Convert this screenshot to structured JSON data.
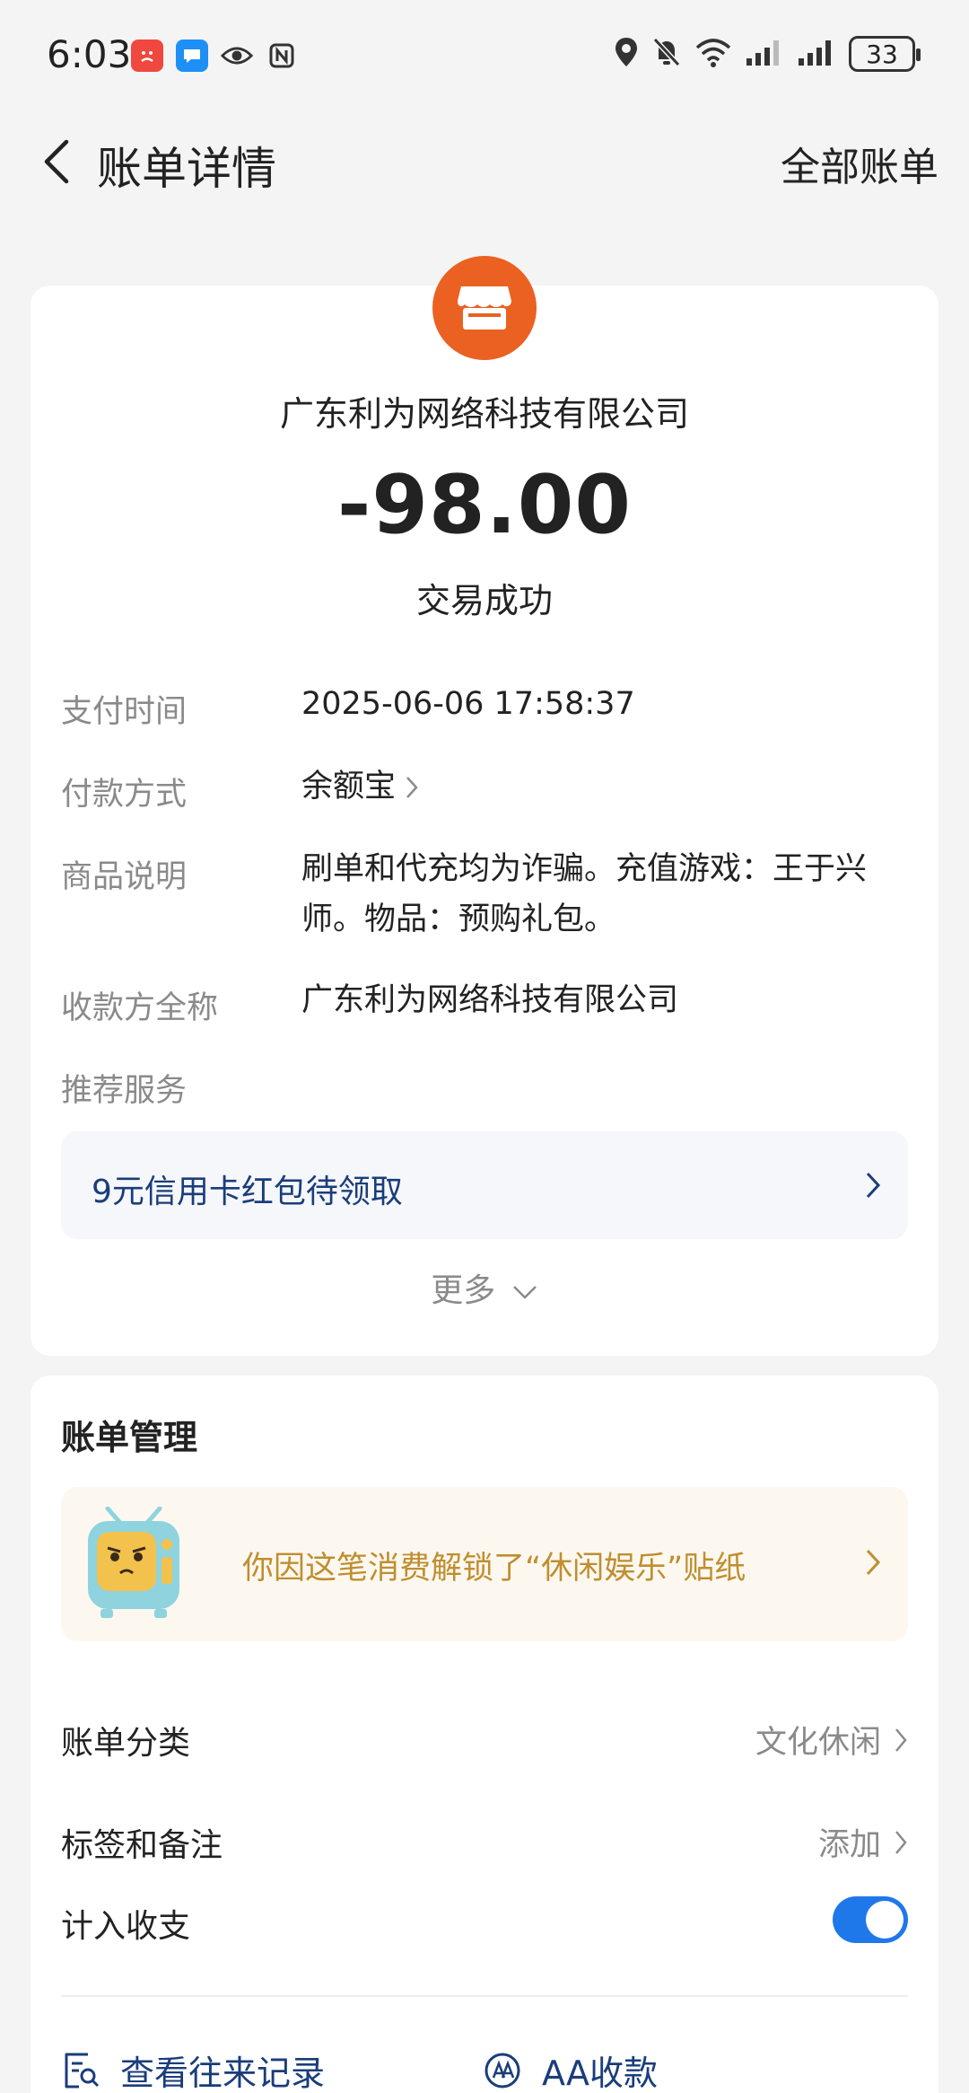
{
  "status_bar": {
    "time": "6:03",
    "battery": "33",
    "left_icons": [
      "app-notification-icon",
      "message-icon",
      "eye-icon",
      "nfc-icon"
    ],
    "right_icons": [
      "location-icon",
      "mute-icon",
      "wifi-icon",
      "signal-icon",
      "signal-icon"
    ]
  },
  "header": {
    "title": "账单详情",
    "right_link": "全部账单"
  },
  "transaction": {
    "merchant": "广东利为网络科技有限公司",
    "amount": "-98.00",
    "status": "交易成功",
    "accent_color": "#ea6122",
    "details": [
      {
        "label": "支付时间",
        "value": "2025-06-06 17:58:37"
      },
      {
        "label": "付款方式",
        "value": "余额宝"
      },
      {
        "label": "商品说明",
        "value": "刷单和代充均为诈骗。充值游戏：王于兴师。物品：预购礼包。"
      },
      {
        "label": "收款方全称",
        "value": "广东利为网络科技有限公司"
      },
      {
        "label": "推荐服务",
        "value": ""
      }
    ],
    "promo": "9元信用卡红包待领取",
    "more": "更多"
  },
  "management": {
    "title": "账单管理",
    "sticker_text": "你因这笔消费解锁了“休闲娱乐”贴纸",
    "rows": [
      {
        "label": "账单分类",
        "value": "文化休闲"
      },
      {
        "label": "标签和备注",
        "value": "添加"
      },
      {
        "label": "计入收支",
        "toggle": true
      }
    ],
    "actions": [
      {
        "label": "查看往来记录",
        "icon": "records-icon"
      },
      {
        "label": "AA收款",
        "icon": "aa-icon"
      }
    ],
    "toggle_color": "#1f78ea"
  }
}
